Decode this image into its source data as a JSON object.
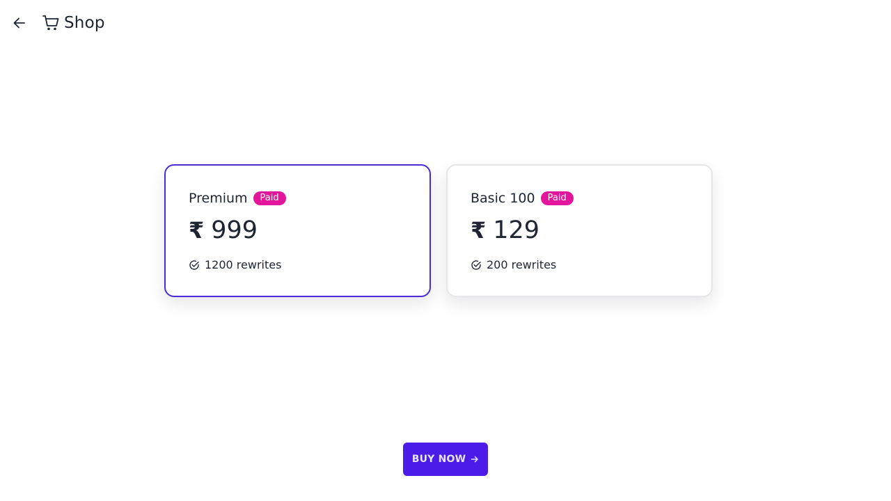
{
  "header": {
    "back_icon": "arrow-left-icon",
    "cart_icon": "shopping-cart-icon",
    "title": "Shop"
  },
  "plans": [
    {
      "name": "Premium",
      "badge": "Paid",
      "currency_symbol": "₹",
      "price": "999",
      "feature": "1200 rewrites",
      "selected": true
    },
    {
      "name": "Basic 100",
      "badge": "Paid",
      "currency_symbol": "₹",
      "price": "129",
      "feature": "200 rewrites",
      "selected": false
    }
  ],
  "buy_button": {
    "label": "BUY NOW",
    "icon": "arrow-right-icon"
  },
  "colors": {
    "accent": "#4b1be8",
    "selected_border": "#4b2bd9",
    "badge": "#e3169b",
    "text": "#1f2433"
  }
}
